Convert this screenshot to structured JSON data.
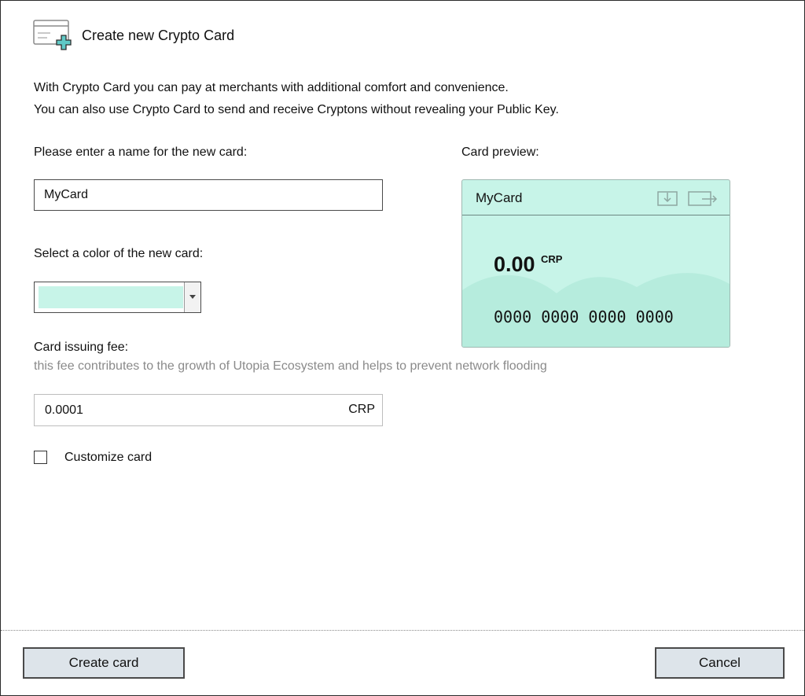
{
  "dialog": {
    "title": "Create new Crypto Card"
  },
  "intro": {
    "line1": "With Crypto Card you can pay at merchants with additional comfort and convenience.",
    "line2": "You can also use Crypto Card to send and receive Cryptons without revealing your Public Key."
  },
  "name_field": {
    "label": "Please enter a name for the new card:",
    "value": "MyCard"
  },
  "color_field": {
    "label": "Select a color of the new card:",
    "selected_color": "#c7f4e8"
  },
  "fee": {
    "label": "Card issuing fee:",
    "hint": "this fee contributes to the growth of Utopia Ecosystem and helps to prevent network flooding",
    "value": "0.0001",
    "unit": "CRP"
  },
  "customize": {
    "label": "Customize card",
    "checked": false
  },
  "preview": {
    "label": "Card preview:",
    "card_name": "MyCard",
    "balance": "0.00",
    "currency": "CRP",
    "number": "0000 0000 0000 0000",
    "icons": [
      "receive-icon",
      "send-icon"
    ]
  },
  "buttons": {
    "create": "Create card",
    "cancel": "Cancel"
  },
  "colors": {
    "card_background": "#c7f4e8",
    "button_background": "#dde4ea",
    "accent_teal": "#5fc9c6"
  }
}
